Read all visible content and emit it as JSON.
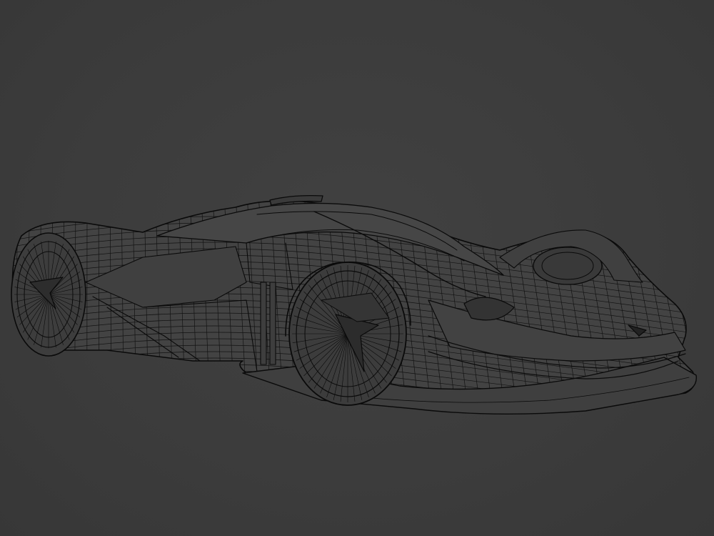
{
  "viewport": {
    "background_color": "#3c3c3c",
    "wire_color": "#0a0a0a",
    "body_fill_color": "#454545",
    "subject": "wireframe-hypercar-model"
  }
}
